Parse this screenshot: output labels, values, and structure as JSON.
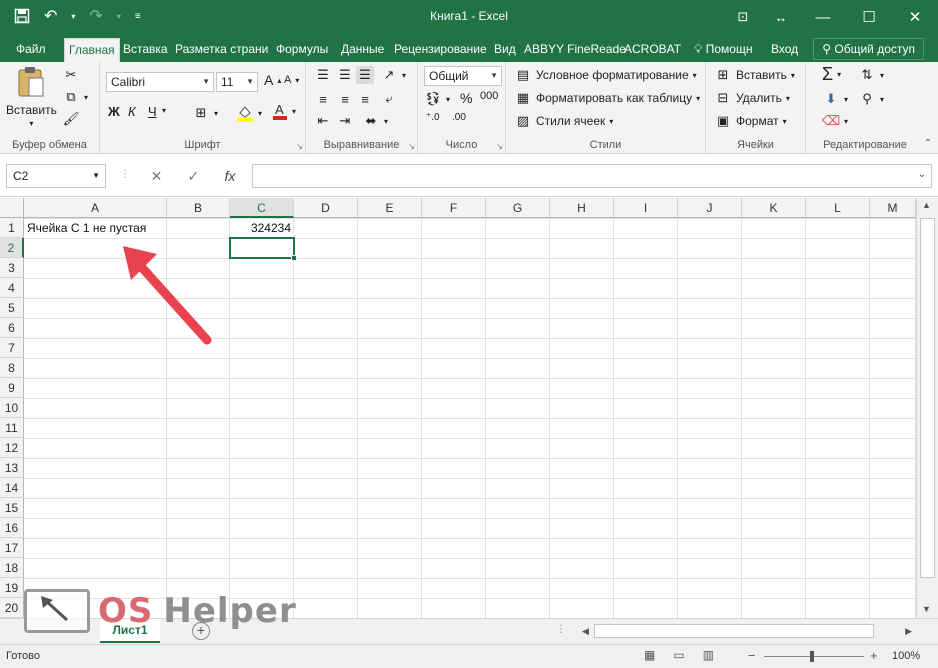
{
  "window": {
    "title": "Книга1 - Excel",
    "qat": {
      "save_icon": "save-icon",
      "undo_icon": "undo-icon",
      "redo_icon": "redo-icon"
    },
    "controls": {
      "ribbon_options": "⊡",
      "restore_sizes": "↔",
      "minimize": "—",
      "maximize": "☐",
      "close": "✕"
    }
  },
  "tabs": [
    {
      "label": "Файл"
    },
    {
      "label": "Главная",
      "active": true
    },
    {
      "label": "Вставка"
    },
    {
      "label": "Разметка страни"
    },
    {
      "label": "Формулы"
    },
    {
      "label": "Данные"
    },
    {
      "label": "Рецензирование"
    },
    {
      "label": "Вид"
    },
    {
      "label": "ABBYY FineReade"
    },
    {
      "label": "ACROBAT"
    },
    {
      "label": "Помощн"
    },
    {
      "label": "Вход"
    }
  ],
  "share_label": "Общий доступ",
  "ribbon": {
    "clipboard": {
      "paste_label": "Вставить",
      "group_label": "Буфер обмена"
    },
    "font": {
      "font_name": "Calibri",
      "font_size": "11",
      "bold": "Ж",
      "italic": "К",
      "underline": "Ч",
      "group_label": "Шрифт"
    },
    "alignment": {
      "group_label": "Выравнивание"
    },
    "number": {
      "format": "Общий",
      "group_label": "Число"
    },
    "styles": {
      "conditional": "Условное форматирование",
      "as_table": "Форматировать как таблицу",
      "cell_styles": "Стили ячеек",
      "group_label": "Стили"
    },
    "cells": {
      "insert": "Вставить",
      "delete": "Удалить",
      "format": "Формат",
      "group_label": "Ячейки"
    },
    "editing": {
      "group_label": "Редактирование"
    }
  },
  "formula_bar": {
    "name_box": "C2",
    "cancel": "✕",
    "enter": "✓",
    "fx": "fx",
    "value": ""
  },
  "grid": {
    "columns": [
      "A",
      "B",
      "C",
      "D",
      "E",
      "F",
      "G",
      "H",
      "I",
      "J",
      "K",
      "L",
      "M"
    ],
    "selected_column": "C",
    "rows": [
      "1",
      "2",
      "3",
      "4",
      "5",
      "6",
      "7",
      "8",
      "9",
      "10",
      "11",
      "12",
      "13",
      "14",
      "15",
      "16",
      "17",
      "18",
      "19",
      "20"
    ],
    "selected_row": "2",
    "cells": {
      "A1": "Ячейка С 1 не пустая",
      "C1": "324234"
    },
    "active_cell": "C2"
  },
  "sheets": [
    {
      "label": "Лист1",
      "active": true
    }
  ],
  "status": {
    "ready": "Готово",
    "zoom": "100%"
  },
  "watermark": {
    "os": "OS",
    "helper": "Helper"
  },
  "colors": {
    "accent": "#217346",
    "arrow": "#e8434f"
  }
}
